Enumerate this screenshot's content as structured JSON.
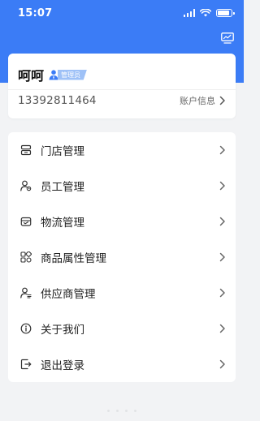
{
  "status_bar": {
    "time": "15:07",
    "battery_level": 0.85
  },
  "header": {
    "color": "#3b7cf6",
    "action_icon": "monitor-chart-icon"
  },
  "user": {
    "name": "呵呵",
    "role": "管理员",
    "role_icon": "admin-user-icon",
    "phone": "13392811464",
    "account_label": "账户信息"
  },
  "menu": {
    "items": [
      {
        "label": "门店管理",
        "icon": "store-icon"
      },
      {
        "label": "员工管理",
        "icon": "staff-icon"
      },
      {
        "label": "物流管理",
        "icon": "logistics-icon"
      },
      {
        "label": "商品属性管理",
        "icon": "product-attributes-icon"
      },
      {
        "label": "供应商管理",
        "icon": "supplier-icon"
      },
      {
        "label": "关于我们",
        "icon": "info-icon"
      },
      {
        "label": "退出登录",
        "icon": "logout-icon"
      }
    ]
  }
}
